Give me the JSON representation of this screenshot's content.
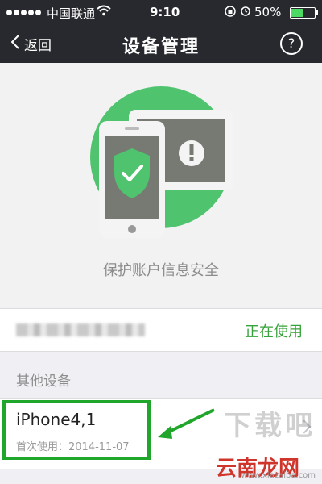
{
  "status_bar": {
    "carrier": "中国联通",
    "time": "9:10",
    "battery_percent": "50%",
    "battery_level": 0.5
  },
  "nav": {
    "back_label": "返回",
    "title": "设备管理",
    "help_symbol": "?"
  },
  "hero": {
    "caption": "保护账户信息安全"
  },
  "current_device": {
    "status": "正在使用"
  },
  "other_devices": {
    "section_title": "其他设备",
    "items": [
      {
        "name": "iPhone4,1",
        "first_used": "首次使用：2014-11-07"
      }
    ]
  },
  "watermark": {
    "site_cn": "云南龙网",
    "logo_text": "下载吧",
    "url": "www.xiazaiba.com"
  },
  "colors": {
    "nav_bg": "#28292e",
    "green": "#36a33a",
    "highlight_green": "#21a62c",
    "hero_circle": "#4fc36e"
  }
}
